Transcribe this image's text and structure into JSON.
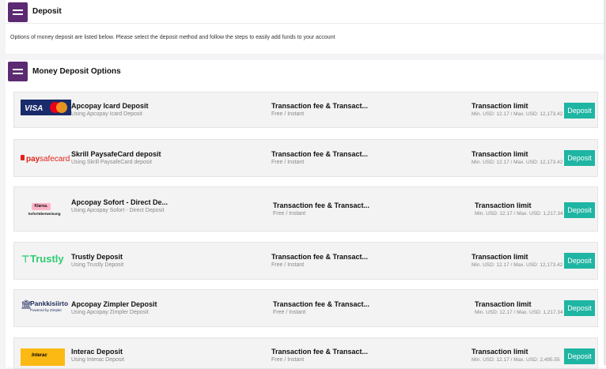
{
  "header": {
    "title": "Deposit"
  },
  "description": "Options of money deposit are listed below. Please select the deposit method and follow the steps to easily add funds to your account",
  "options_header": {
    "title": "Money Deposit Options"
  },
  "methods": [
    {
      "logo": "visa-mastercard-logo",
      "name": "Apcopay Icard Deposit",
      "subtitle": "Using Apcopay Icard Deposit",
      "fee_title": "Transaction fee & Transact...",
      "fee_value": "Free / Instant",
      "limit_title": "Transaction limit",
      "limit_value": "Min. USD: 12.17 / Max. USD: 12,173.42",
      "button": "Deposit"
    },
    {
      "logo": "paysafecard-logo",
      "name": "Skrill PaysafeCard deposit",
      "subtitle": "Using Skrill PaysafeCard deposit",
      "fee_title": "Transaction fee & Transact...",
      "fee_value": "Free / Instant",
      "limit_title": "Transaction limit",
      "limit_value": "Min. USD: 12.17 / Max. USD: 12,173.42",
      "button": "Deposit"
    },
    {
      "logo": "klarna-sofort-logo",
      "logo_text_1": "Klarna.",
      "logo_text_2": "Sofortüberweisung",
      "name": "Apcopay Sofort - Direct De...",
      "subtitle": "Using Apcopay Sofort - Direct Deposit",
      "fee_title": "Transaction fee & Transact...",
      "fee_value": "Free / Instant",
      "limit_title": "Transaction limit",
      "limit_value": "Min. USD: 12.17 / Max. USD: 1,217.34",
      "button": "Deposit"
    },
    {
      "logo": "trustly-logo",
      "logo_text": "Trustly",
      "name": "Trustly Deposit",
      "subtitle": "Using Trustly Deposit",
      "fee_title": "Transaction fee & Transact...",
      "fee_value": "Free / Instant",
      "limit_title": "Transaction limit",
      "limit_value": "Min. USD: 12.17 / Max. USD: 12,173.42",
      "button": "Deposit"
    },
    {
      "logo": "pankkisiirto-logo",
      "logo_text_1": "Pankkisiirto",
      "logo_text_2": "Powered by Zimpler",
      "name": "Apcopay Zimpler Deposit",
      "subtitle": "Using Apcopay Zimpler Deposit",
      "fee_title": "Transaction fee & Transact...",
      "fee_value": "Free / Instant",
      "limit_title": "Transaction limit",
      "limit_value": "Min. USD: 12.17 / Max. USD: 1,217.34",
      "button": "Deposit"
    },
    {
      "logo": "interac-logo",
      "logo_text": "Interac",
      "name": "Interac Deposit",
      "subtitle": "Using Interac Deposit",
      "fee_title": "Transaction fee & Transact...",
      "fee_value": "Free / Instant",
      "limit_title": "Transaction limit",
      "limit_value": "Min. USD: 12.17 / Max. USD: 2,495.55",
      "button": "Deposit"
    }
  ],
  "colors": {
    "brand": "#5b2a72",
    "button": "#1fb5a3",
    "trustly": "#2ecc71",
    "paysafe": "#e2231a"
  }
}
